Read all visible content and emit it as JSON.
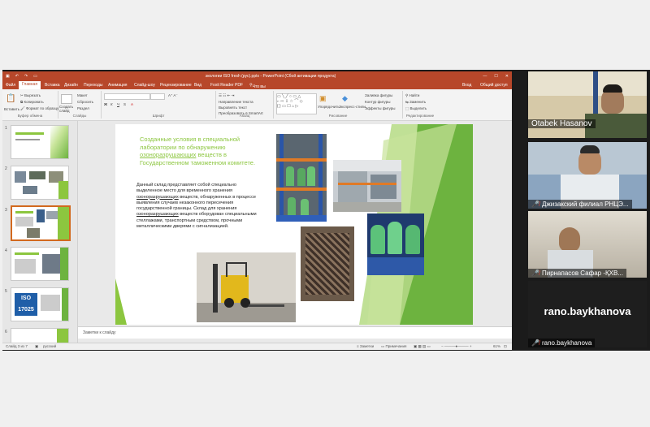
{
  "ppt": {
    "title": "экологии ISO fresh (рус).pptx - PowerPoint (Сбой активации продукта)",
    "signin": "Вход",
    "share": "Общий доступ",
    "tabs": [
      "Файл",
      "Главная",
      "Вставка",
      "Дизайн",
      "Переходы",
      "Анимация",
      "Слайд-шоу",
      "Рецензирование",
      "Вид",
      "Foxit Reader PDF"
    ],
    "tell_me": "Что вы хотите сделать?",
    "ribbon": {
      "clipboard": {
        "label": "Буфер обмена",
        "paste": "Вставить",
        "cut": "Вырезать",
        "copy": "Копировать",
        "format": "Формат по образцу"
      },
      "slides": {
        "label": "Слайды",
        "create": "Создать слайд",
        "layout": "Макет",
        "reset": "Сбросить",
        "section": "Раздел"
      },
      "font": {
        "label": "Шрифт"
      },
      "paragraph": {
        "label": "Абзац",
        "direction": "Направление текста",
        "align": "Выровнять текст",
        "smartart": "Преобразовать в SmartArt"
      },
      "drawing": {
        "label": "Рисование",
        "arrange": "Упорядочить",
        "styles": "Экспресс-стили",
        "fill": "Заливка фигуры",
        "outline": "Контур фигуры",
        "effects": "Эффекты фигуры"
      },
      "editing": {
        "label": "Редактирование",
        "find": "Найти",
        "replace": "Заменить",
        "select": "Выделить"
      }
    },
    "thumb_numbers": [
      "1",
      "2",
      "3",
      "4",
      "5",
      "6"
    ],
    "notes_placeholder": "Заметки к слайду",
    "status": {
      "slide": "Слайд 3 из 7",
      "lang": "русский",
      "notes": "Заметки",
      "comments": "Примечания",
      "zoom": "61%"
    }
  },
  "slide": {
    "title_plain": "Созданные условия в специальной лаборатории по обнаружению ",
    "title_underlined": "озоноразрушающих",
    "title_rest": " веществ в Государственном таможенном комитете.",
    "body_1": "Данный склад представляет собой специально выделенное место для временного хранения ",
    "body_u1": "озоноразрушающих",
    "body_2": " веществ, обнаруженных в процессе выявления случаев незаконного пересечения государственной границы. Склад для хранения ",
    "body_u2": "озоноразрушающих",
    "body_3": " веществ оборудован специальными стеллажами, транспортным средством, прочными металлическими дверями с сигнализацией."
  },
  "participants": [
    {
      "name": "Otabek Hasanov",
      "muted": false
    },
    {
      "name": "Джизакский филиал РНЦЭ...",
      "muted": true
    },
    {
      "name": "Пирнапасов Сафар -ҚХВ...",
      "muted": true
    },
    {
      "name": "rano.baykhanova",
      "muted": true
    }
  ],
  "colors": {
    "ppt_accent": "#b7472a",
    "slide_green": "#8cc63f",
    "muted_mic": "#e74c3c"
  }
}
